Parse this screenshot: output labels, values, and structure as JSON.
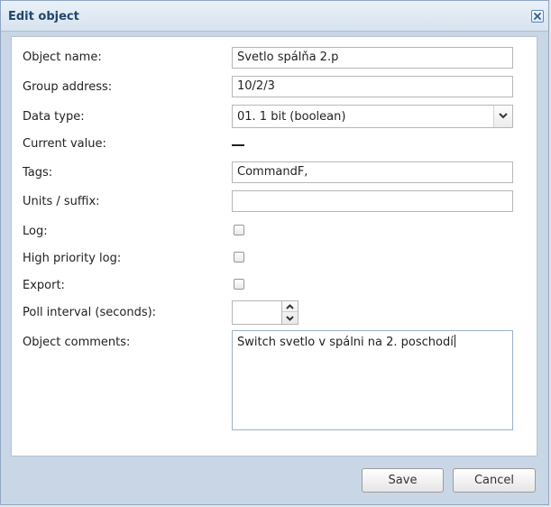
{
  "dialog": {
    "title": "Edit object"
  },
  "form": {
    "object_name": {
      "label": "Object name:",
      "value": "Svetlo spálňa 2.p"
    },
    "group_address": {
      "label": "Group address:",
      "value": "10/2/3"
    },
    "data_type": {
      "label": "Data type:",
      "value": "01. 1 bit (boolean)"
    },
    "current_value": {
      "label": "Current value:",
      "value": "—"
    },
    "tags": {
      "label": "Tags:",
      "value": "CommandF,"
    },
    "units_suffix": {
      "label": "Units / suffix:",
      "value": ""
    },
    "log": {
      "label": "Log:",
      "checked": false
    },
    "high_priority_log": {
      "label": "High priority log:",
      "checked": false
    },
    "export": {
      "label": "Export:",
      "checked": false
    },
    "poll_interval": {
      "label": "Poll interval (seconds):",
      "value": ""
    },
    "object_comments": {
      "label": "Object comments:",
      "value": "Switch svetlo v spálni na 2. poschodí"
    }
  },
  "buttons": {
    "save_label": "Save",
    "cancel_label": "Cancel"
  },
  "icons": {
    "close": "close-icon",
    "dropdown": "chevron-down-icon",
    "spin_up": "chevron-up-icon",
    "spin_down": "chevron-down-icon"
  },
  "colors": {
    "title_text": "#21456f",
    "dialog_border": "#8fa6c4",
    "footer_background": "#c9d6e5"
  }
}
